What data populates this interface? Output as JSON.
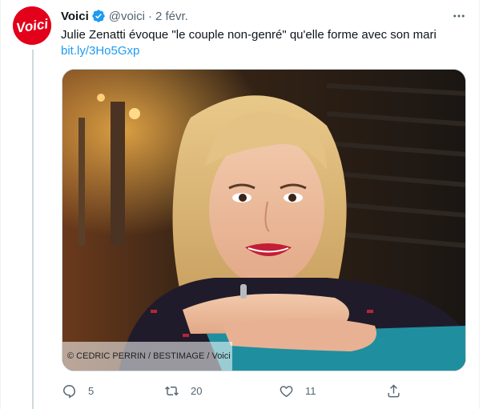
{
  "tweet": {
    "author_name": "Voici",
    "author_handle": "@voici",
    "separator": "·",
    "date": "2 févr.",
    "text": "Julie Zenatti évoque \"le couple non-genré\" qu'elle forme avec son mari",
    "link": "bit.ly/3Ho5Gxp",
    "image_credit": "© CEDRIC PERRIN / BESTIMAGE / Voici",
    "avatar_logo_text": "Voici"
  },
  "actions": {
    "replies": "5",
    "retweets": "20",
    "likes": "11"
  },
  "icons": {
    "verified": "verified-badge-icon",
    "more": "more-horizontal-icon",
    "reply": "reply-icon",
    "retweet": "retweet-icon",
    "like": "heart-icon",
    "share": "share-icon"
  },
  "colors": {
    "brand_red": "#e2001a",
    "link_blue": "#1d9bf0",
    "muted_text": "#536471",
    "verified_blue": "#1d9bf0"
  }
}
